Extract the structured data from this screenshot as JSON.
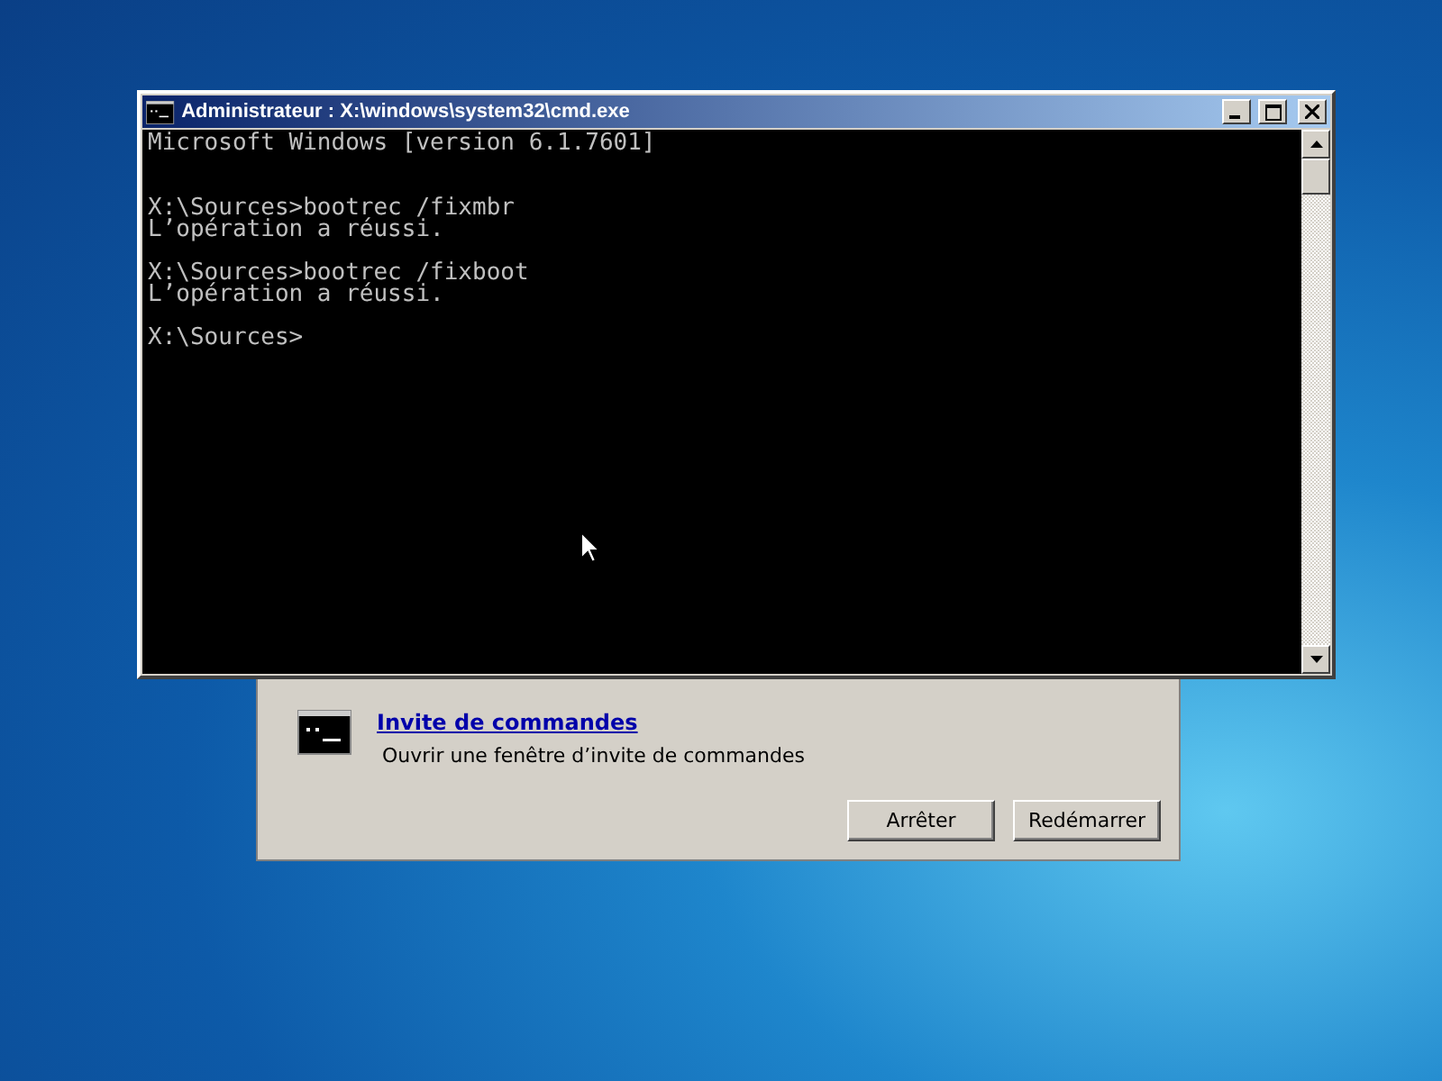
{
  "console_window": {
    "title": "Administrateur : X:\\windows\\system32\\cmd.exe",
    "output": "Microsoft Windows [version 6.1.7601]\n\n\nX:\\Sources>bootrec /fixmbr\nL’opération a réussi.\n\nX:\\Sources>bootrec /fixboot\nL’opération a réussi.\n\nX:\\Sources>"
  },
  "recovery_dialog": {
    "tool_link": "Invite de commandes",
    "tool_description": "Ouvrir une fenêtre d’invite de commandes",
    "buttons": [
      {
        "label": "Arrêter"
      },
      {
        "label": "Redémarrer"
      }
    ]
  }
}
